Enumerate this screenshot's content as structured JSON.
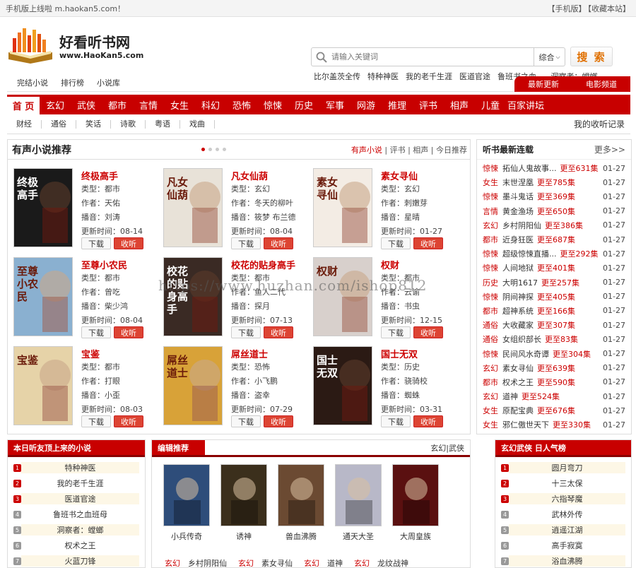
{
  "topbar": {
    "notice": "手机版上线啦 m.haokan5.com！",
    "links": [
      "【手机版】",
      "【收藏本站】"
    ]
  },
  "logo": {
    "name": "好看听书网",
    "url_text": "www.HaoKan5.com"
  },
  "search": {
    "placeholder": "请输入关键词",
    "scope": "综合",
    "button": "搜 索"
  },
  "hot_keywords": [
    "比尔盖茨全传",
    "特种神医",
    "我的老千生涯",
    "医道官途",
    "鲁班书之血...",
    "洞察者：螳螂"
  ],
  "subnav": {
    "links": [
      "完结小说",
      "排行榜",
      "小说库"
    ],
    "right": [
      "最新更新",
      "电影频道"
    ]
  },
  "mainnav": [
    "首 页",
    "玄幻",
    "武侠",
    "都市",
    "言情",
    "女生",
    "科幻",
    "恐怖",
    "惊悚",
    "历史",
    "军事",
    "网游",
    "推理",
    "评书",
    "相声",
    "儿童",
    "百家讲坛"
  ],
  "catnav": {
    "items": [
      "财经",
      "通俗",
      "笑话",
      "诗歌",
      "粤语",
      "戏曲"
    ],
    "history": "我的收听记录"
  },
  "recommend": {
    "title": "有声小说推荐",
    "links": [
      "有声小说",
      "评书",
      "相声",
      "今日推荐"
    ],
    "labels": {
      "type": "类型：",
      "author": "作者：",
      "narrator": "播音：",
      "updated": "更新时间：",
      "download": "下载",
      "listen": "收听"
    },
    "books": [
      {
        "title": "终极高手",
        "type": "都市",
        "author": "天佑",
        "narrator": "刘涛",
        "updated": "08-14",
        "cover": "#1a1a1a",
        "cover_text": "终极高手"
      },
      {
        "title": "凡女仙葫",
        "type": "玄幻",
        "author": "冬天的柳叶",
        "narrator": "筱梦 布兰德",
        "updated": "08-04",
        "cover": "#e8e2d8",
        "cover_text": "凡女仙葫"
      },
      {
        "title": "素女寻仙",
        "type": "玄幻",
        "author": "刺嫩芽",
        "narrator": "星晴",
        "updated": "01-27",
        "cover": "#f3ece4",
        "cover_text": "素女寻仙"
      },
      {
        "title": "至尊小农民",
        "type": "都市",
        "author": "曾吃",
        "narrator": "柴少鸿",
        "updated": "08-04",
        "cover": "#8ab0d0",
        "cover_text": "至尊小农民"
      },
      {
        "title": "校花的贴身高手",
        "type": "都市",
        "author": "鱼人二代",
        "narrator": "探月",
        "updated": "07-13",
        "cover": "#3a2a24",
        "cover_text": "校花的贴身高手"
      },
      {
        "title": "权财",
        "type": "都市",
        "author": "云谕",
        "narrator": "书虫",
        "updated": "12-15",
        "cover": "#d8d0cc",
        "cover_text": "权财"
      },
      {
        "title": "宝鉴",
        "type": "都市",
        "author": "打眼",
        "narrator": "小歪",
        "updated": "08-03",
        "cover": "#e6d3a8",
        "cover_text": "宝鉴"
      },
      {
        "title": "屌丝道士",
        "type": "恐怖",
        "author": "小飞鹏",
        "narrator": "盗幸",
        "updated": "07-29",
        "cover": "#d8a238",
        "cover_text": "屌丝道士"
      },
      {
        "title": "国士无双",
        "type": "历史",
        "author": "骁骑校",
        "narrator": "蜘蛛",
        "updated": "03-31",
        "cover": "#2b1a14",
        "cover_text": "国士无双"
      }
    ]
  },
  "latest": {
    "title": "听书最新连载",
    "more": "更多>>",
    "items": [
      {
        "cat": "惊悚",
        "title": "拓仙人鬼故事...",
        "update": "更至631集",
        "date": "01-27"
      },
      {
        "cat": "女生",
        "title": "末世涅凰",
        "update": "更至785集",
        "date": "01-27"
      },
      {
        "cat": "惊悚",
        "title": "墨斗鬼话",
        "update": "更至369集",
        "date": "01-27"
      },
      {
        "cat": "言情",
        "title": "黄金渔场",
        "update": "更至650集",
        "date": "01-27"
      },
      {
        "cat": "玄幻",
        "title": "乡村阴阳仙",
        "update": "更至386集",
        "date": "01-27"
      },
      {
        "cat": "都市",
        "title": "近身狂医",
        "update": "更至687集",
        "date": "01-27"
      },
      {
        "cat": "惊悚",
        "title": "超级惊悚直播...",
        "update": "更至292集",
        "date": "01-27"
      },
      {
        "cat": "惊悚",
        "title": "人间地狱",
        "update": "更至401集",
        "date": "01-27"
      },
      {
        "cat": "历史",
        "title": "大明1617",
        "update": "更至257集",
        "date": "01-27"
      },
      {
        "cat": "惊悚",
        "title": "阴间神探",
        "update": "更至405集",
        "date": "01-27"
      },
      {
        "cat": "都市",
        "title": "超神系统",
        "update": "更至166集",
        "date": "01-27"
      },
      {
        "cat": "通俗",
        "title": "大收藏家",
        "update": "更至307集",
        "date": "01-27"
      },
      {
        "cat": "通俗",
        "title": "女组织部长",
        "update": "更至83集",
        "date": "01-27"
      },
      {
        "cat": "惊悚",
        "title": "民间风水奇谭",
        "update": "更至304集",
        "date": "01-27"
      },
      {
        "cat": "玄幻",
        "title": "素女寻仙",
        "update": "更至639集",
        "date": "01-27"
      },
      {
        "cat": "都市",
        "title": "权术之王",
        "update": "更至590集",
        "date": "01-27"
      },
      {
        "cat": "玄幻",
        "title": "道神",
        "update": "更至524集",
        "date": "01-27"
      },
      {
        "cat": "女生",
        "title": "原配宝典",
        "update": "更至676集",
        "date": "01-27"
      },
      {
        "cat": "女生",
        "title": "邪仁傲世天下",
        "update": "更至330集",
        "date": "01-27"
      }
    ]
  },
  "top_today": {
    "title": "本日听友顶上来的小说",
    "items": [
      "特种神医",
      "我的老千生涯",
      "医道官途",
      "鲁班书之血班母",
      "洞察者：螳螂",
      "权术之王",
      "火蓝刀锋"
    ]
  },
  "editor": {
    "title": "编辑推荐",
    "tags": "玄幻|武侠",
    "books": [
      {
        "name": "小兵传奇",
        "cover": "#2e4d7a"
      },
      {
        "name": "诱神",
        "cover": "#3b2f1c"
      },
      {
        "name": "兽血沸腾",
        "cover": "#6b4a32"
      },
      {
        "name": "通天大圣",
        "cover": "#b8b8c8"
      },
      {
        "name": "大周皇族",
        "cover": "#5a1010"
      }
    ],
    "bottom": [
      {
        "cat": "玄幻",
        "name": "乡村阴阳仙"
      },
      {
        "cat": "玄幻",
        "name": "素女寻仙"
      },
      {
        "cat": "玄幻",
        "name": "道神"
      },
      {
        "cat": "玄幻",
        "name": "龙纹战神"
      }
    ]
  },
  "xuanhuan": {
    "title": "玄幻武侠 日人气榜",
    "items": [
      "圆月弯刀",
      "十三太保",
      "六指琴魔",
      "武林外传",
      "逍遥江湖",
      "高手寂寞",
      "浴血沸腾"
    ]
  },
  "watermark": "https://www.huzhan.com/ishop812"
}
